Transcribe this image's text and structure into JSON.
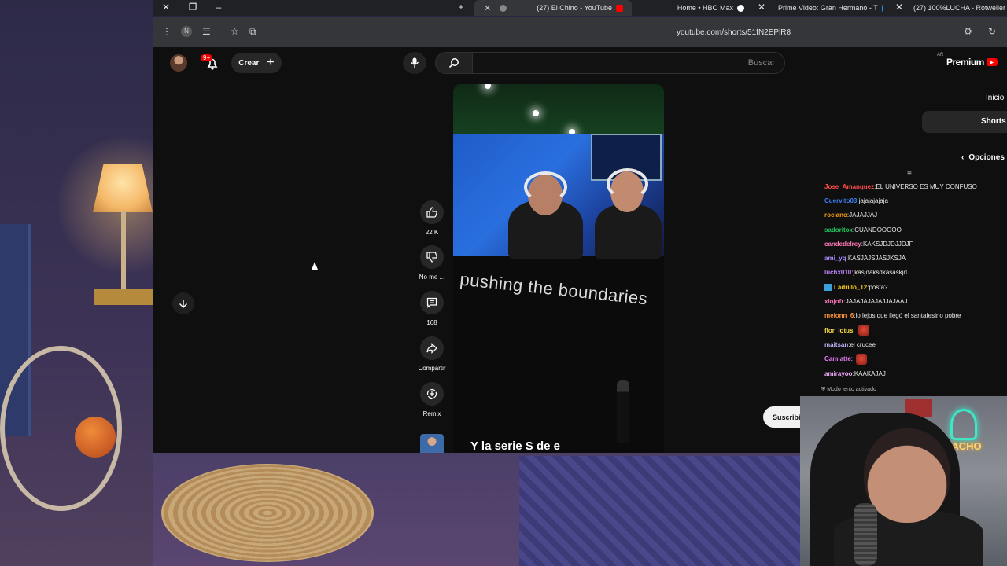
{
  "browser": {
    "tabs": [
      {
        "label": "(27) 100%LUCHA - Rotweiler",
        "active": false
      },
      {
        "label": "Prime Video: Gran Hermano - T",
        "active": false
      },
      {
        "label": "Home • HBO Max",
        "active": false
      },
      {
        "label": "(27) El Chino - YouTube",
        "active": true
      }
    ],
    "url": "youtube.com/shorts/51fN2EPlR8"
  },
  "youtube": {
    "search_placeholder": "Buscar",
    "create_label": "Crear",
    "notification_count": "9+",
    "logo_text": "Premium",
    "country_code": "AR",
    "sidebar": {
      "home": "Inicio",
      "shorts": "Shorts",
      "options": "Opciones"
    }
  },
  "short": {
    "caption_overlay": "pushing the boundaries",
    "subtitle": "Y la serie S de e",
    "actions": {
      "like_count": "22 K",
      "dislike_label": "No me ...",
      "comment_count": "168",
      "share_label": "Compartir",
      "remix_label": "Remix"
    },
    "subscribe_label": "Suscribirme"
  },
  "chat": {
    "messages": [
      {
        "user": "Jose_Amanquez",
        "color": "#ff4d4d",
        "text": "EL UNIVERSO ES MUY CONFUSO"
      },
      {
        "user": "Cuervito03",
        "color": "#3b82f6",
        "text": "jajajajajaja"
      },
      {
        "user": "rociano",
        "color": "#f59e0b",
        "text": "JAJAJJAJ"
      },
      {
        "user": "sadoritox",
        "color": "#22c55e",
        "text": "CUANDOOOOO"
      },
      {
        "user": "candedelrey",
        "color": "#ff7ab8",
        "text": "KAKSJDJDJJDJF"
      },
      {
        "user": "ami_yq",
        "color": "#a78bfa",
        "text": "KASJAJSJASJKSJA"
      },
      {
        "user": "luchx010",
        "color": "#c084fc",
        "text": "jkasjdaksdkasaskjd"
      },
      {
        "user": "Ladrillo_12",
        "color": "#facc15",
        "text": "posta?"
      },
      {
        "user": "xlojofr",
        "color": "#f472b6",
        "text": "JAJAJAJAJAJJAJAAJ"
      },
      {
        "user": "meionn_6",
        "color": "#fb923c",
        "text": "lo lejos que llegó el santafesino pobre"
      },
      {
        "user": "flor_lotus",
        "color": "#fde047",
        "text": ""
      },
      {
        "user": "maitsan",
        "color": "#c4b5fd",
        "text": "el crucee"
      },
      {
        "user": "Camiatte",
        "color": "#e879f9",
        "text": ""
      },
      {
        "user": "amirayoo",
        "color": "#f0abfc",
        "text": "KAAKAJAJ"
      }
    ],
    "footer": "Modo lento activado"
  },
  "webcam": {
    "neon_text": "NACHO"
  },
  "colors": {
    "accent": "#ff0000",
    "background": "#0f0f0f"
  }
}
